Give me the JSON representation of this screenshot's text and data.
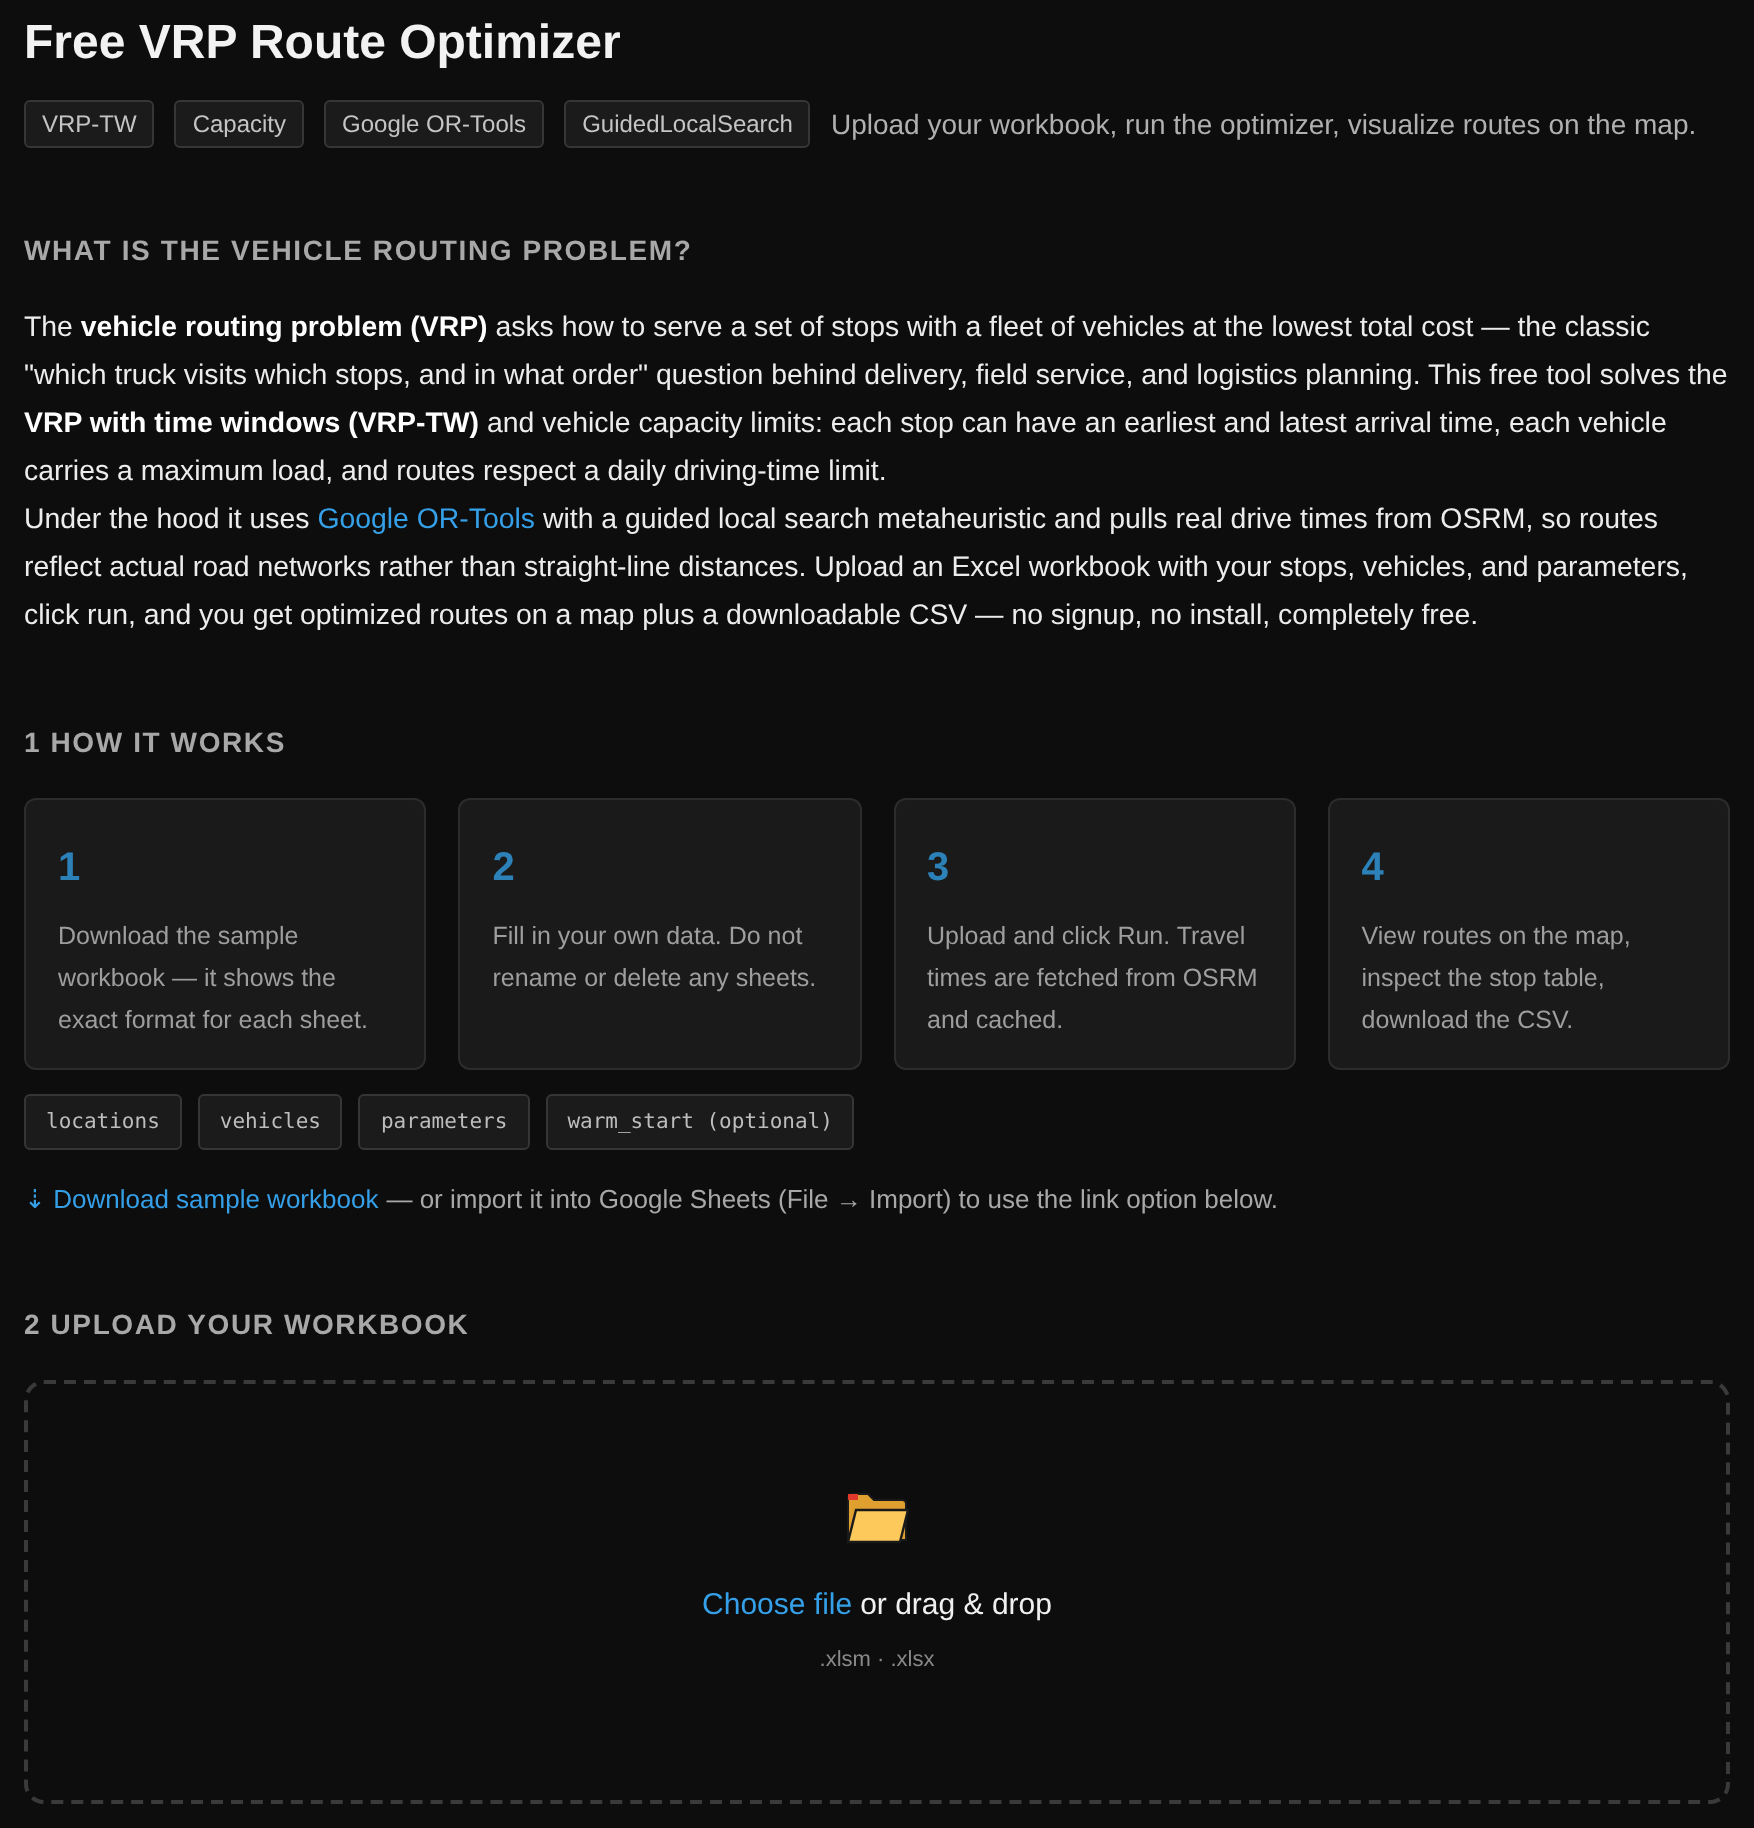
{
  "header": {
    "title": "Free VRP Route Optimizer",
    "tags": [
      "VRP-TW",
      "Capacity",
      "Google OR-Tools",
      "GuidedLocalSearch"
    ],
    "tagline": "Upload your workbook, run the optimizer, visualize routes on the map."
  },
  "intro": {
    "heading": "WHAT IS THE VEHICLE ROUTING PROBLEM?",
    "paragraphs": [
      [
        {
          "kind": "text",
          "text": "The **vehicle routing problem (VRP)** asks how to serve a set of stops with a fleet of vehicles at the lowest total cost — the classic \"which truck visits which stops, and in what order\" question behind delivery, field service, and logistics planning. This free tool solves the **VRP with time windows (VRP-TW)** and vehicle capacity limits: each stop can have an earliest and latest arrival time, each vehicle carries a maximum load, and routes respect a daily driving-time limit."
        }
      ],
      [
        {
          "kind": "text",
          "text": "Under the hood it uses "
        },
        {
          "kind": "link",
          "text": "Google OR-Tools"
        },
        {
          "kind": "text",
          "text": " with a guided local search metaheuristic and pulls real drive times from OSRM, so routes reflect actual road networks rather than straight-line distances. Upload an Excel workbook with your stops, vehicles, and parameters, click run, and you get optimized routes on a map plus a downloadable CSV — no signup, no install, completely free."
        }
      ]
    ]
  },
  "how_it_works": {
    "heading": "1 HOW IT WORKS",
    "steps": [
      {
        "number": "1",
        "text": "Download the sample workbook — it shows the exact format for each sheet."
      },
      {
        "number": "2",
        "text": "Fill in your own data. Do not rename or delete any sheets."
      },
      {
        "number": "3",
        "text": "Upload and click Run. Travel times are fetched from OSRM and cached."
      },
      {
        "number": "4",
        "text": "View routes on the map, inspect the stop table, download the CSV."
      }
    ],
    "sheets": [
      "locations",
      "vehicles",
      "parameters",
      "warm_start (optional)"
    ],
    "download_note": {
      "link": "⇣ Download sample workbook",
      "text": "— or import it into Google Sheets (File → Import) to use the link option below."
    }
  },
  "upload": {
    "heading": "2 UPLOAD YOUR WORKBOOK",
    "link": "Choose file",
    "text": "or drag & drop",
    "formats": ".xlsm · .xlsx"
  }
}
